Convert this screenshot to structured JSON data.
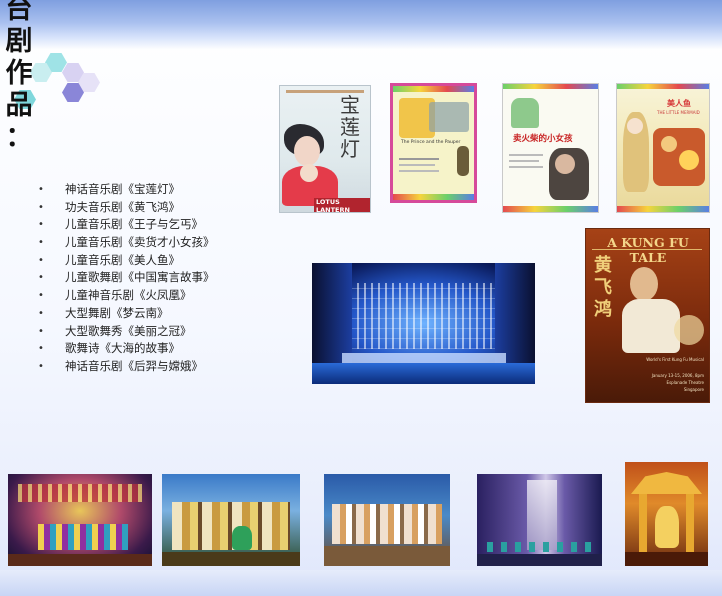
{
  "title": "台剧作品：",
  "title_chars": [
    "台",
    "剧",
    "作",
    "品",
    "："
  ],
  "productions": [
    "神话音乐剧《宝莲灯》",
    "功夫音乐剧《黄飞鸿》",
    "儿童音乐剧《王子与乞丐》",
    "儿童音乐剧《卖货才小女孩》",
    "儿童音乐剧《美人鱼》",
    "儿童歌舞剧《中国寓言故事》",
    "儿童神音乐剧《火凤凰》",
    "大型舞剧《梦云南》",
    "大型歌舞秀《美丽之冠》",
    "歌舞诗《大海的故事》",
    "神话音乐剧《后羿与嫦娥》"
  ],
  "bullet": "•",
  "posters": {
    "lotus": {
      "title": "宝莲灯",
      "subtitle": "LOTUS LANTERN"
    },
    "prince": {
      "title": "The Prince and the Pauper"
    },
    "matchgirl": {
      "title": "卖火柴的小女孩"
    },
    "mermaid": {
      "title": "美人鱼",
      "subtitle": "THE LITTLE MERMAID"
    },
    "kungfu": {
      "title": "A KUNG FU TALE",
      "chinese": "黄飞鸿",
      "tagline": "World's First Kung Fu Musical",
      "date": "January 13-15, 2006, 8pm",
      "venue": "Esplanade Theatre",
      "city": "Singapore"
    }
  },
  "colors": {
    "accent": "#7f9fe0",
    "text": "#222222"
  }
}
